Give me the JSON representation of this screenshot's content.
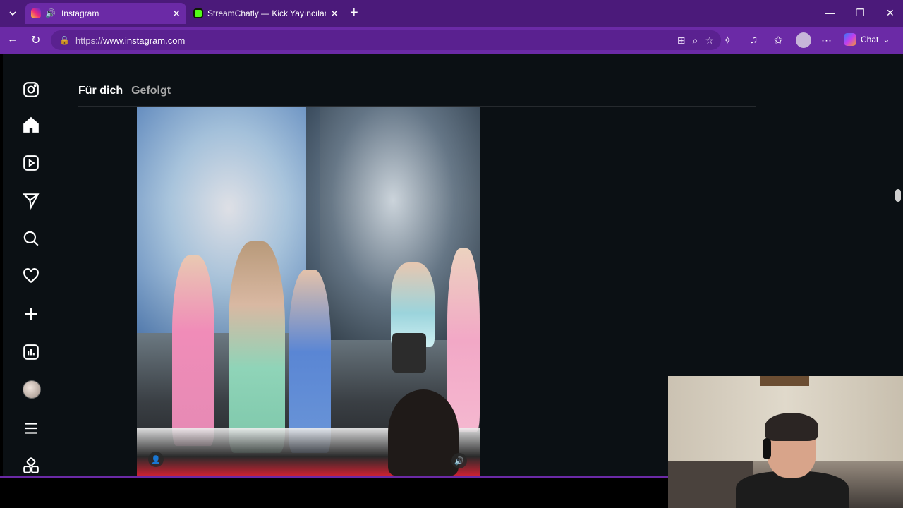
{
  "browser": {
    "tabs": [
      {
        "title": "Instagram",
        "active": true,
        "favicon": "instagram-icon"
      },
      {
        "title": "StreamChatly — Kick Yayıncıları için",
        "active": false,
        "favicon": "streamchatly-icon"
      }
    ],
    "url_prefix": "https://",
    "url_host": "www.instagram.com",
    "chat_label": "Chat",
    "accent_color": "#6b2aa6",
    "tabbar_color": "#4b1a7a"
  },
  "instagram": {
    "feed_tabs": [
      {
        "label": "Für dich",
        "active": true
      },
      {
        "label": "Gefolgt",
        "active": false
      }
    ],
    "page_background": "#0b1014"
  }
}
